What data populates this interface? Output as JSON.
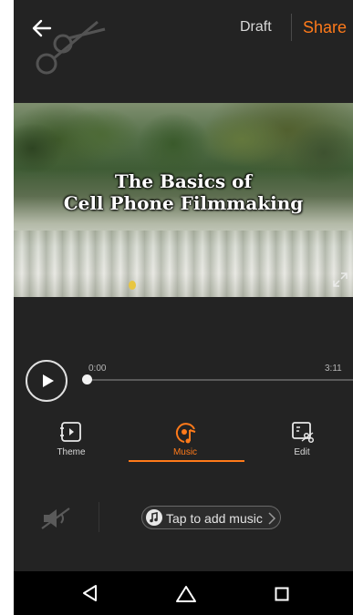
{
  "header": {
    "draft_label": "Draft",
    "share_label": "Share"
  },
  "video": {
    "title_line1": "The Basics of",
    "title_line2": "Cell Phone Filmmaking"
  },
  "player": {
    "time_current": "0:00",
    "time_total": "3:11",
    "progress": 0
  },
  "tabs": [
    {
      "label": "Theme",
      "icon": "theme-icon",
      "active": false
    },
    {
      "label": "Music",
      "icon": "music-icon",
      "active": true
    },
    {
      "label": "Edit",
      "icon": "edit-icon",
      "active": false
    }
  ],
  "music": {
    "add_label": "Tap to add music"
  },
  "colors": {
    "accent": "#ff7a1a",
    "background": "#232323",
    "navbar": "#000000"
  }
}
